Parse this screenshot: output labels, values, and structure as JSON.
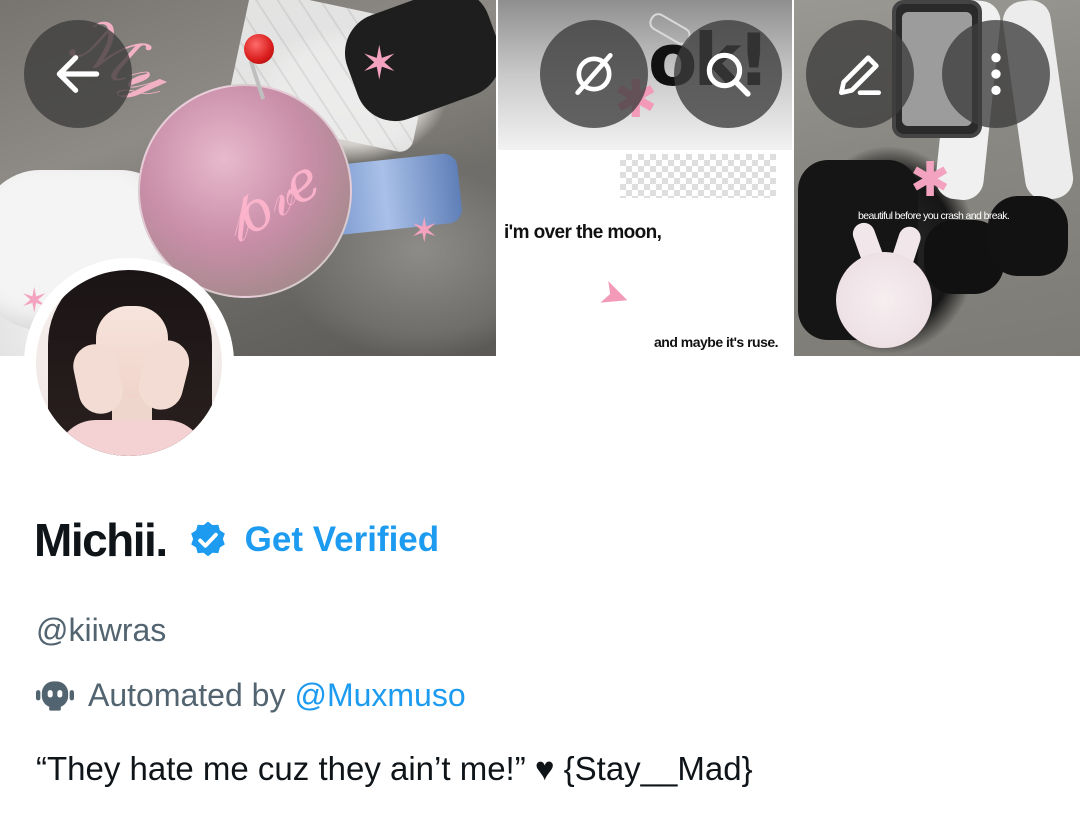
{
  "header": {
    "back_icon": "arrow-left-icon",
    "grok_icon": "grok-icon",
    "search_icon": "search-icon",
    "edit_icon": "pencil-icon",
    "more_icon": "more-vertical-icon"
  },
  "banner": {
    "collage_text_1": "i'm over the moon,",
    "collage_text_2": "and maybe it's ruse.",
    "collage_text_3": "beautiful before you crash and break."
  },
  "profile": {
    "display_name": "Michii.",
    "verified_badge_icon": "verified-badge-icon",
    "get_verified_label": "Get Verified",
    "handle": "@kiiwras",
    "automated_icon": "bot-icon",
    "automated_label": "Automated by",
    "automated_by": "@Muxmuso",
    "bio": "“They hate me cuz they ain’t me!”  ♥  {Stay__Mad}"
  },
  "colors": {
    "accent": "#1d9bf0",
    "secondary_text": "#536471",
    "primary_text": "#0f1419",
    "overlay_button": "#3c3c3c"
  }
}
